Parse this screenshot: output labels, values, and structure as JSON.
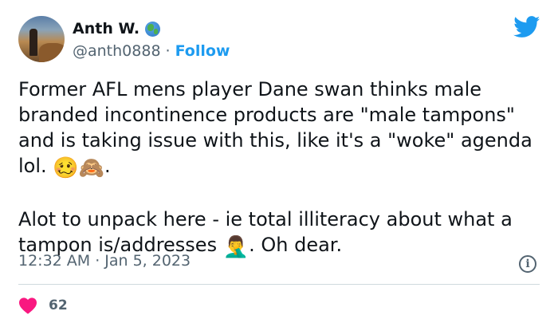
{
  "author": {
    "display_name": "Anth W.",
    "handle": "@anth0888",
    "separator": "·",
    "follow_label": "Follow"
  },
  "tweet": {
    "paragraph1": "Former AFL mens player Dane swan thinks male branded incontinence products are \"male tampons\" and is taking issue with this, like it's a \"woke\" agenda lol.",
    "paragraph1_emoji": "🥴🙈",
    "paragraph1_end": ".",
    "paragraph2": "Alot to unpack here - ie total illiteracy about what a tampon is/addresses",
    "paragraph2_emoji": "🤦‍♂️",
    "paragraph2_end": ". Oh dear."
  },
  "meta": {
    "time": "12:32 AM",
    "separator": "·",
    "date": "Jan 5, 2023"
  },
  "engagement": {
    "likes": "62"
  },
  "colors": {
    "accent": "#1d9bf0",
    "heart": "#f91880",
    "muted": "#536471",
    "text": "#0f1419"
  },
  "icons": [
    "avatar",
    "globe-icon",
    "twitter-bird-icon",
    "info-icon",
    "heart-icon"
  ]
}
